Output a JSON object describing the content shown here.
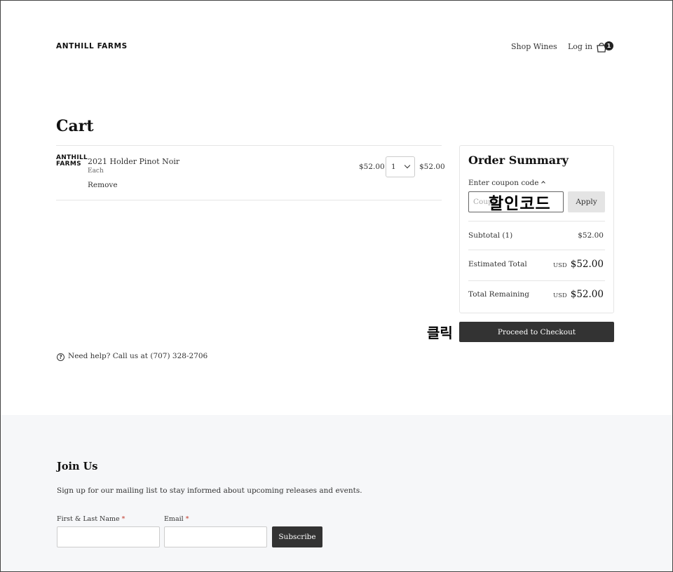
{
  "header": {
    "logo": "ANTHILL FARMS",
    "nav_shop": "Shop Wines",
    "nav_login": "Log in",
    "cart_count": "1",
    "cart_icon": "shopping-bag-icon"
  },
  "cart": {
    "title": "Cart",
    "items": [
      {
        "logo_line1": "ANTHILL",
        "logo_line2": "FARMS",
        "name": "2021 Holder Pinot Noir",
        "unit": "Each",
        "remove_label": "Remove",
        "price": "$52.00",
        "quantity": "1",
        "total": "$52.00"
      }
    ],
    "help_text": "Need help? Call us at (707) 328-2706"
  },
  "summary": {
    "title": "Order Summary",
    "coupon_toggle": "Enter coupon code",
    "coupon_placeholder": "Coupon",
    "coupon_overlay": "할인코드",
    "apply_label": "Apply",
    "subtotal_label": "Subtotal (1)",
    "subtotal_value": "$52.00",
    "estimated_label": "Estimated Total",
    "estimated_currency": "USD",
    "estimated_value": "$52.00",
    "remaining_label": "Total Remaining",
    "remaining_currency": "USD",
    "remaining_value": "$52.00",
    "click_overlay": "클릭",
    "checkout_label": "Proceed to Checkout"
  },
  "footer": {
    "title": "Join Us",
    "description": "Sign up for our mailing list to stay informed about upcoming releases and events.",
    "name_label": "First & Last Name",
    "email_label": "Email",
    "required_mark": "*",
    "subscribe_label": "Subscribe"
  }
}
